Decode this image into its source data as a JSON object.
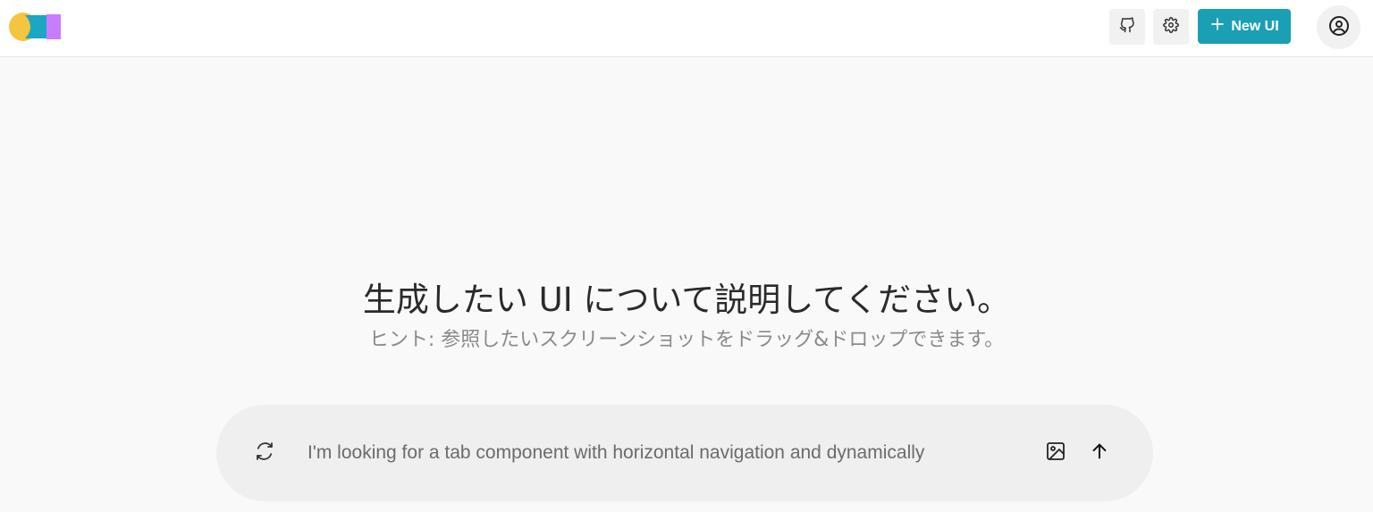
{
  "header": {
    "logo_name": "app-logo",
    "github_icon": "github-icon",
    "settings_icon": "gear-icon",
    "new_button_label": "New UI",
    "new_button_icon": "plus-icon",
    "account_icon": "user-circle-icon"
  },
  "main": {
    "heading": "生成したい UI について説明してください。",
    "hint": "ヒント: 参照したいスクリーンショットをドラッグ&ドロップできます。"
  },
  "prompt": {
    "placeholder": "I'm looking for a tab component with horizontal navigation and dynamically",
    "value": "",
    "refresh_icon": "refresh-icon",
    "image_icon": "image-icon",
    "send_icon": "arrow-up-icon"
  },
  "colors": {
    "accent": "#1a9fb5",
    "logo_yellow": "#f5c542",
    "logo_teal": "#1aa7c4",
    "logo_purple": "#c77dff",
    "page_bg": "#f9f9f9"
  }
}
